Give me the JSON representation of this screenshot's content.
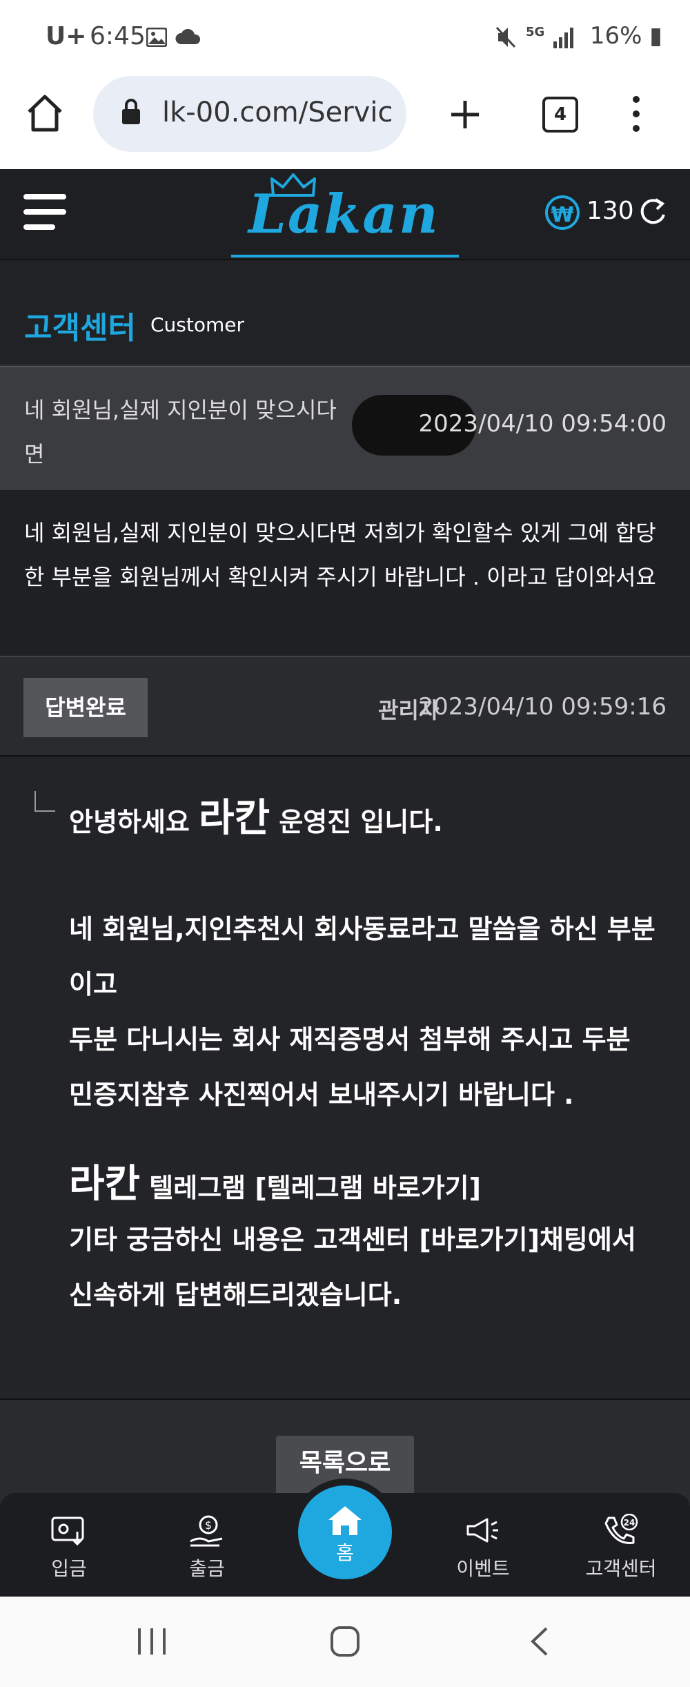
{
  "status": {
    "carrier": "U+",
    "time": "6:45",
    "network": "5G",
    "battery": "16%"
  },
  "browser": {
    "url": "lk-00.com/Servic",
    "tab_count": "4"
  },
  "header": {
    "logo": "Lakan",
    "currency_symbol": "₩",
    "balance": "130"
  },
  "section": {
    "title": "고객센터",
    "subtitle": "Customer"
  },
  "question": {
    "subject": "네 회원님,실제 지인분이 맞으시다면",
    "date": "2023/04/10 09:54:00",
    "body": "네 회원님,실제 지인분이 맞으시다면 저희가 확인할수 있게 그에 합당한 부분을 회원님께서 확인시켜 주시기 바랍니다 . 이라고 답이와서요"
  },
  "answer": {
    "status": "답변완료",
    "author": "관리자",
    "date": "2023/04/10 09:59:16",
    "greeting_pre": "안녕하세요",
    "greeting_brand": "라칸",
    "greeting_post": "운영진 입니다.",
    "para1": "네 회원님,지인추천시 회사동료라고 말씀을 하신 부분이고",
    "para2": "두분 다니시는 회사 재직증명서 첨부해 주시고 두분 민증지참후 사진찍어서 보내주시기 바랍니다 .",
    "telegram_brand": "라칸",
    "telegram_text": "텔레그램 [텔레그램  바로가기]",
    "para3": "기타 궁금하신 내용은 고객센터  [바로가기]채팅에서 신속하게 답변해드리겠습니다."
  },
  "list_button": "목록으로",
  "bottom_nav": {
    "deposit": "입금",
    "withdraw": "출금",
    "home": "홈",
    "event": "이벤트",
    "support": "고객센터",
    "support_badge": "24"
  }
}
